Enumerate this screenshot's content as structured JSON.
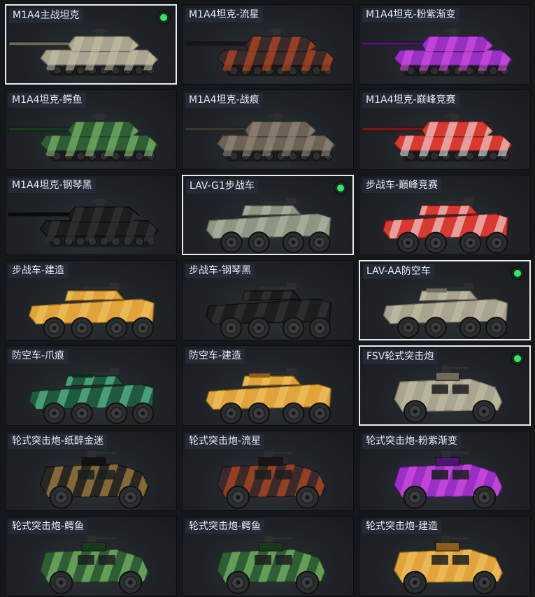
{
  "items": [
    {
      "label": "M1A4主战坦克",
      "vehicle": "tank",
      "camo": "sand",
      "selected": true
    },
    {
      "label": "M1A4坦克-流星",
      "vehicle": "tank",
      "camo": "meteor",
      "selected": false
    },
    {
      "label": "M1A4坦克-粉紫渐变",
      "vehicle": "tank",
      "camo": "purple",
      "selected": false
    },
    {
      "label": "M1A4坦克-鳄鱼",
      "vehicle": "tank",
      "camo": "croc",
      "selected": false
    },
    {
      "label": "M1A4坦克-战痕",
      "vehicle": "tank",
      "camo": "scar",
      "selected": false
    },
    {
      "label": "M1A4坦克-巅峰竞赛",
      "vehicle": "tank",
      "camo": "race",
      "selected": false
    },
    {
      "label": "M1A4坦克-钢琴黑",
      "vehicle": "tank",
      "camo": "black",
      "selected": false
    },
    {
      "label": "LAV-G1步战车",
      "vehicle": "ifv",
      "camo": "green",
      "selected": true
    },
    {
      "label": "步战车-巅峰竞赛",
      "vehicle": "ifv",
      "camo": "race",
      "selected": false
    },
    {
      "label": "步战车-建造",
      "vehicle": "ifv",
      "camo": "yellow",
      "selected": false
    },
    {
      "label": "步战车-钢琴黑",
      "vehicle": "ifv",
      "camo": "black",
      "selected": false
    },
    {
      "label": "LAV-AA防空车",
      "vehicle": "aa",
      "camo": "sand",
      "selected": true
    },
    {
      "label": "防空车-爪痕",
      "vehicle": "aa",
      "camo": "claw",
      "selected": false
    },
    {
      "label": "防空车-建造",
      "vehicle": "aa",
      "camo": "yellow",
      "selected": false
    },
    {
      "label": "FSV轮式突击炮",
      "vehicle": "fsv",
      "camo": "sand",
      "selected": true
    },
    {
      "label": "轮式突击炮-纸醉金迷",
      "vehicle": "fsv",
      "camo": "gold",
      "selected": false
    },
    {
      "label": "轮式突击炮-流星",
      "vehicle": "fsv",
      "camo": "meteor",
      "selected": false
    },
    {
      "label": "轮式突击炮-粉紫渐变",
      "vehicle": "fsv",
      "camo": "purple",
      "selected": false
    },
    {
      "label": "轮式突击炮-鳄鱼",
      "vehicle": "fsv",
      "camo": "croc",
      "selected": false
    },
    {
      "label": "轮式突击炮-鳄鱼",
      "vehicle": "fsv",
      "camo": "croc",
      "selected": false
    },
    {
      "label": "轮式突击炮-建造",
      "vehicle": "fsv",
      "camo": "yellow",
      "selected": false
    }
  ],
  "camo_colors": {
    "sand": {
      "base": "#a9a48f",
      "dark": "#6f6b5c",
      "accent": "#c9c3aa"
    },
    "meteor": {
      "base": "#3a2a2a",
      "dark": "#1c1416",
      "accent": "#e0501e"
    },
    "purple": {
      "base": "#9a2fc4",
      "dark": "#4b1670",
      "accent": "#e055e8"
    },
    "croc": {
      "base": "#2f5e34",
      "dark": "#183a1d",
      "accent": "#8fd07a"
    },
    "scar": {
      "base": "#6d6258",
      "dark": "#3c3631",
      "accent": "#9a8f82"
    },
    "race": {
      "base": "#d83a32",
      "dark": "#7a1714",
      "accent": "#f2f2f2"
    },
    "black": {
      "base": "#1d1d1f",
      "dark": "#0b0b0c",
      "accent": "#3a3a3d"
    },
    "green": {
      "base": "#8d9682",
      "dark": "#5d6555",
      "accent": "#b7bfad"
    },
    "yellow": {
      "base": "#e0a43a",
      "dark": "#8a5f17",
      "accent": "#f3c969"
    },
    "claw": {
      "base": "#1f5a40",
      "dark": "#0e2b1f",
      "accent": "#6fd6a6"
    },
    "gold": {
      "base": "#2a2722",
      "dark": "#121110",
      "accent": "#c8a24b"
    }
  }
}
